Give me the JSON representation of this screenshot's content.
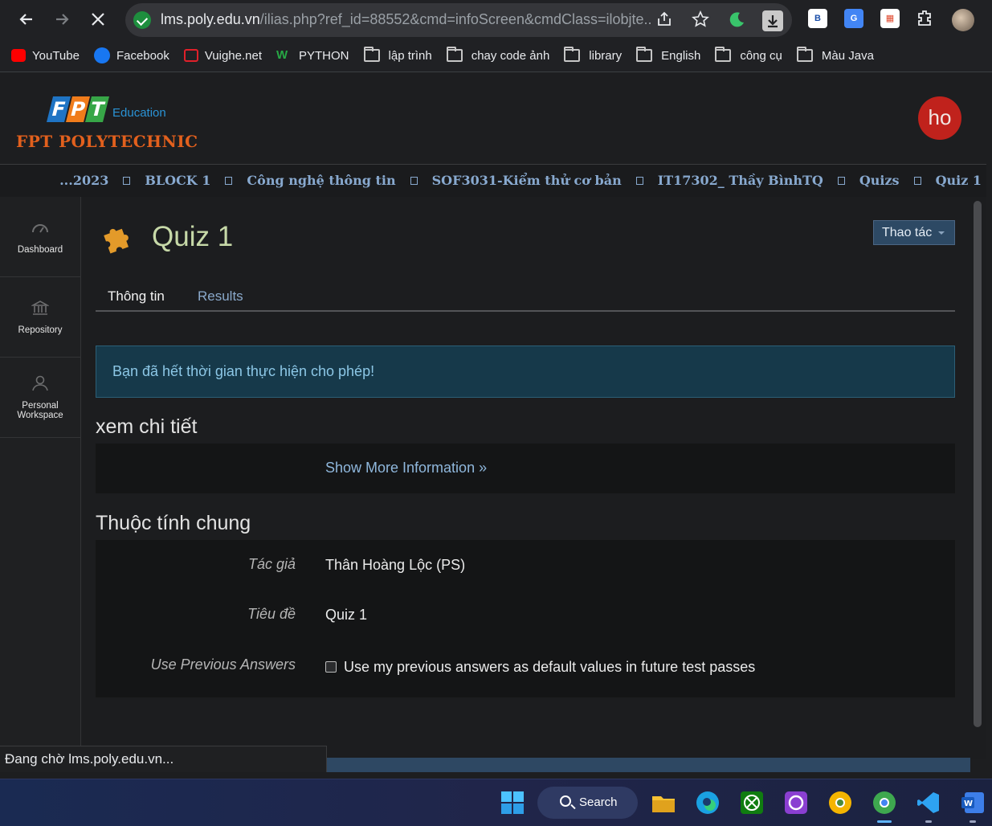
{
  "browser": {
    "url_host": "lms.poly.edu.vn",
    "url_path": "/ilias.php?ref_id=88552&cmd=infoScreen&cmdClass=ilobjte...",
    "bookmarks": [
      {
        "label": "YouTube",
        "icon": "youtube-icon",
        "color": "#ff0000"
      },
      {
        "label": "Facebook",
        "icon": "facebook-icon",
        "color": "#1877f2"
      },
      {
        "label": "Vuighe.net",
        "icon": "vuighe-icon",
        "color": "#e0202a"
      },
      {
        "label": "PYTHON",
        "icon": "w-icon",
        "color": "#27a845"
      },
      {
        "label": "lập trình",
        "icon": "folder-icon"
      },
      {
        "label": "chay code ảnh",
        "icon": "folder-icon"
      },
      {
        "label": "library",
        "icon": "folder-icon"
      },
      {
        "label": "English",
        "icon": "folder-icon"
      },
      {
        "label": "công cụ",
        "icon": "folder-icon"
      },
      {
        "label": "Màu Java",
        "icon": "folder-icon"
      }
    ],
    "status_text": "Đang chờ lms.poly.edu.vn..."
  },
  "header": {
    "logo_letters": [
      "F",
      "P",
      "T"
    ],
    "logo_sub": "Education",
    "logo_name": "FPT POLYTECHNIC",
    "user_initials": "ho",
    "breadcrumbs": [
      "...2023",
      "BLOCK 1",
      "Công nghệ thông tin",
      "SOF3031-Kiểm thử cơ bản",
      "IT17302_ Thầy BìnhTQ",
      "Quizs",
      "Quiz 1"
    ]
  },
  "sidebar": {
    "items": [
      {
        "label": "Dashboard",
        "icon": "dashboard-icon"
      },
      {
        "label": "Repository",
        "icon": "repository-icon"
      },
      {
        "label": "Personal Workspace",
        "label_line1": "Personal",
        "label_line2": "Workspace",
        "icon": "person-icon"
      }
    ]
  },
  "main": {
    "title": "Quiz 1",
    "title_icon": "puzzle-icon",
    "actions_label": "Thao tác",
    "tabs": [
      {
        "label": "Thông tin",
        "active": true
      },
      {
        "label": "Results",
        "active": false
      }
    ],
    "alert": "Bạn đã hết thời gian thực hiện cho phép!",
    "details_heading": "xem chi tiết",
    "show_more": "Show More Information »",
    "properties_heading": "Thuộc tính chung",
    "properties": [
      {
        "label": "Tác giả",
        "value": "Thân Hoàng Lộc (PS)"
      },
      {
        "label": "Tiêu đề",
        "value": "Quiz 1"
      },
      {
        "label": "Use Previous Answers",
        "value": "Use my previous answers as default values in future test passes",
        "checkbox": false
      }
    ]
  },
  "taskbar": {
    "search_label": "Search",
    "apps": [
      "windows-start-icon",
      "file-explorer-icon",
      "edge-icon",
      "xbox-icon",
      "app-icon",
      "chrome-canary-icon",
      "chrome-icon",
      "vscode-icon",
      "word-icon"
    ]
  },
  "colors": {
    "accent_link": "#8aa9cb",
    "title": "#c7d9a8",
    "brand_orange": "#e2601d",
    "user_red": "#c0221c"
  }
}
